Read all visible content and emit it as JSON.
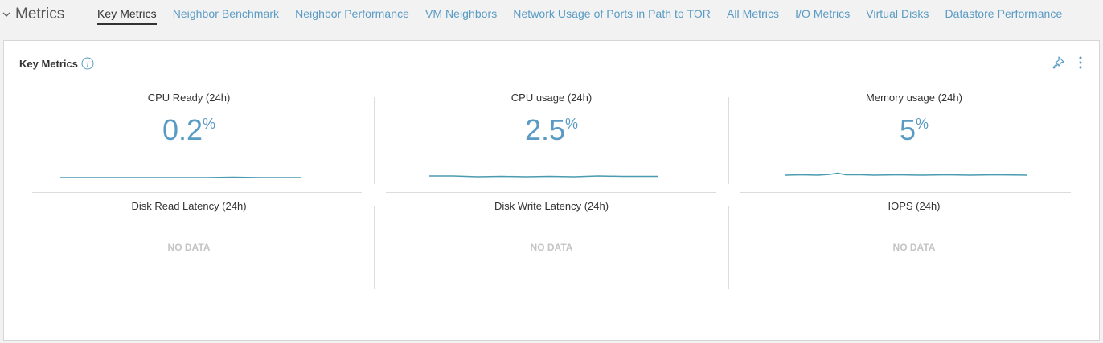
{
  "header": {
    "section_title": "Metrics",
    "tabs": [
      {
        "label": "Key Metrics",
        "active": true
      },
      {
        "label": "Neighbor Benchmark",
        "active": false
      },
      {
        "label": "Neighbor Performance",
        "active": false
      },
      {
        "label": "VM Neighbors",
        "active": false
      },
      {
        "label": "Network Usage of Ports in Path to TOR",
        "active": false
      },
      {
        "label": "All Metrics",
        "active": false
      },
      {
        "label": "I/O Metrics",
        "active": false
      },
      {
        "label": "Virtual Disks",
        "active": false
      },
      {
        "label": "Datastore Performance",
        "active": false
      }
    ]
  },
  "card": {
    "title": "Key Metrics",
    "metrics": [
      {
        "label": "CPU Ready (24h)",
        "value": "0.2",
        "unit": "%",
        "has_data": true
      },
      {
        "label": "CPU usage (24h)",
        "value": "2.5",
        "unit": "%",
        "has_data": true
      },
      {
        "label": "Memory usage (24h)",
        "value": "5",
        "unit": "%",
        "has_data": true
      },
      {
        "label": "Disk Read Latency (24h)",
        "no_data": "NO DATA",
        "has_data": false
      },
      {
        "label": "Disk Write Latency (24h)",
        "no_data": "NO DATA",
        "has_data": false
      },
      {
        "label": "IOPS (24h)",
        "no_data": "NO DATA",
        "has_data": false
      }
    ]
  },
  "colors": {
    "accent": "#5a9bc4",
    "sparkline": "#4a9bb0",
    "no_data": "#c4c4c4"
  },
  "icons": [
    "chevron-down-icon",
    "info-icon",
    "pin-icon",
    "more-vertical-icon"
  ]
}
